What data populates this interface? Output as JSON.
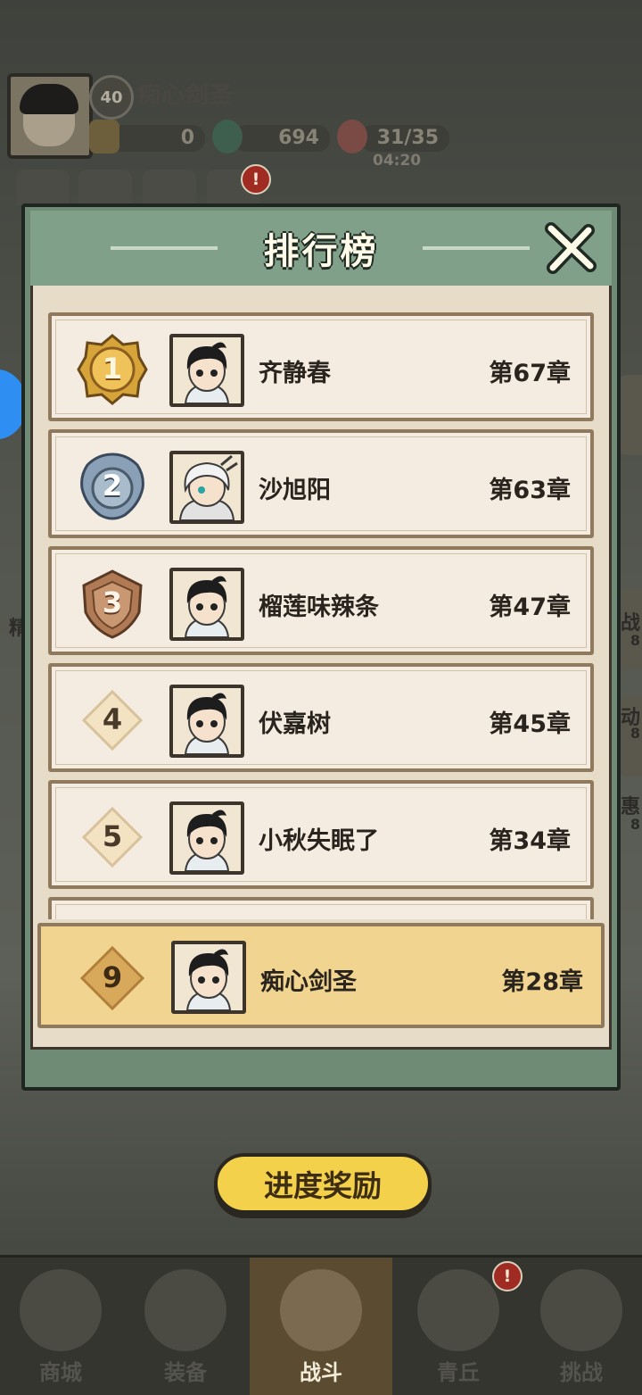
{
  "hud": {
    "level": "40",
    "player_name": "痴心剑圣",
    "gold": "0",
    "jade": "694",
    "stamina": "31/35",
    "stamina_timer": "04:20",
    "alert_badge": "!"
  },
  "side": {
    "right_labels": [
      "战",
      "动",
      "惠"
    ],
    "right_numbers": [
      "8",
      "8",
      "8"
    ],
    "left_label": "精"
  },
  "modal": {
    "title": "排行榜",
    "close_label": "close"
  },
  "ranking": [
    {
      "rank": "1",
      "name": "齐静春",
      "chapter": "第67章"
    },
    {
      "rank": "2",
      "name": "沙旭阳",
      "chapter": "第63章"
    },
    {
      "rank": "3",
      "name": "榴莲味辣条",
      "chapter": "第47章"
    },
    {
      "rank": "4",
      "name": "伏嘉树",
      "chapter": "第45章"
    },
    {
      "rank": "5",
      "name": "小秋失眠了",
      "chapter": "第34章"
    }
  ],
  "self_entry": {
    "rank": "9",
    "name": "痴心剑圣",
    "chapter": "第28章"
  },
  "progress_button": "进度奖励",
  "bottom_nav": [
    {
      "label": "商城",
      "icon": "shop-icon"
    },
    {
      "label": "装备",
      "icon": "armor-icon"
    },
    {
      "label": "战斗",
      "icon": "crossed-swords-icon"
    },
    {
      "label": "青丘",
      "icon": "mountain-icon"
    },
    {
      "label": "挑战",
      "icon": "challenge-icon"
    }
  ],
  "nav_badge": "!",
  "colors": {
    "gold_medal": "#d7a43a",
    "silver_medal": "#8aa0b6",
    "bronze_medal": "#b07a55",
    "self_row": "#f0d490",
    "modal_green": "#81a08a"
  }
}
